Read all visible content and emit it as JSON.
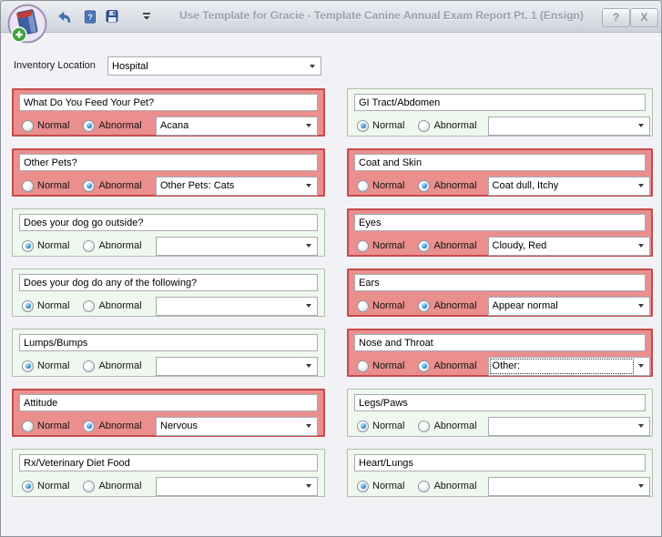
{
  "window": {
    "title": "Use Template for Gracie - Template Canine Annual Exam Report Pt. 1 (Ensign)",
    "help_button": "?",
    "close_button": "X"
  },
  "toolbar": {
    "icons": [
      "app-icon",
      "undo-icon",
      "help-icon",
      "save-icon",
      "toolbar-overflow-icon"
    ]
  },
  "inventory": {
    "label": "Inventory Location",
    "value": "Hospital"
  },
  "radio_labels": {
    "normal": "Normal",
    "abnormal": "Abnormal"
  },
  "colors": {
    "abnormal_fill": "#EA8E8E",
    "abnormal_border": "#C74B4B",
    "normal_fill": "#EFF8EF",
    "normal_border": "#AEBDAE",
    "radio_selected": "#2E77C0",
    "title_text": "#98A0AE"
  },
  "panels": [
    {
      "title": "What Do You Feed Your Pet?",
      "status": "abnormal",
      "value": "Acana"
    },
    {
      "title": "Other Pets?",
      "status": "abnormal",
      "value": "Other Pets: Cats"
    },
    {
      "title": "Does your dog go outside?",
      "status": "normal",
      "value": ""
    },
    {
      "title": "Does your dog do any of the following?",
      "status": "normal",
      "value": ""
    },
    {
      "title": "Lumps/Bumps",
      "status": "normal",
      "value": ""
    },
    {
      "title": "Attitude",
      "status": "abnormal",
      "value": "Nervous"
    },
    {
      "title": "Rx/Veterinary Diet Food",
      "status": "normal",
      "value": ""
    },
    {
      "title": "GI Tract/Abdomen",
      "status": "normal",
      "value": ""
    },
    {
      "title": "Coat and Skin",
      "status": "abnormal",
      "value": "Coat dull, Itchy"
    },
    {
      "title": "Eyes",
      "status": "abnormal",
      "value": "Cloudy, Red"
    },
    {
      "title": "Ears",
      "status": "abnormal",
      "value": "Appear normal"
    },
    {
      "title": "Nose and Throat",
      "status": "abnormal",
      "value": "Other:",
      "focused": true
    },
    {
      "title": "Legs/Paws",
      "status": "normal",
      "value": ""
    },
    {
      "title": "Heart/Lungs",
      "status": "normal",
      "value": ""
    }
  ]
}
